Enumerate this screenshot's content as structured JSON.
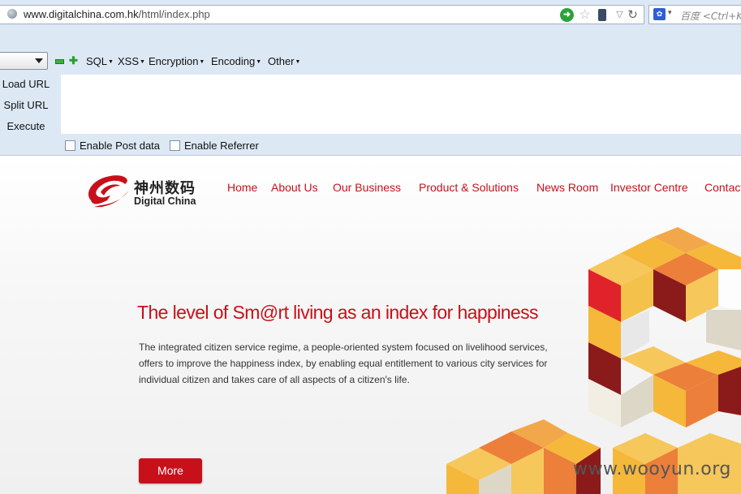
{
  "browser": {
    "url_domain": "www.digitalchina.com.hk",
    "url_path": "/html/index.php",
    "search_placeholder": "百度 <Ctrl+K>"
  },
  "hackbar": {
    "menus": [
      "SQL",
      "XSS",
      "Encryption",
      "Encoding",
      "Other"
    ],
    "actions": [
      "Load URL",
      "Split URL",
      "Execute"
    ],
    "checkboxes": [
      "Enable Post data",
      "Enable Referrer"
    ]
  },
  "site": {
    "logo_cn": "神州数码",
    "logo_en": "Digital China",
    "nav": [
      "Home",
      "About Us",
      "Our Business",
      "Product & Solutions",
      "News Room",
      "Investor Centre",
      "Contact"
    ],
    "headline": "The level of Sm@rt living as an index for happiness",
    "body_lines": [
      "The integrated citizen service regime, a people-oriented system focused on livelihood services,",
      "offers to improve the happiness index, by enabling equal entitlement to various city services for",
      "individual citizen and takes care of all aspects of a citizen's life."
    ],
    "more_label": "More",
    "brand_color": "#c8101a"
  },
  "watermark": "www.wooyun.org"
}
